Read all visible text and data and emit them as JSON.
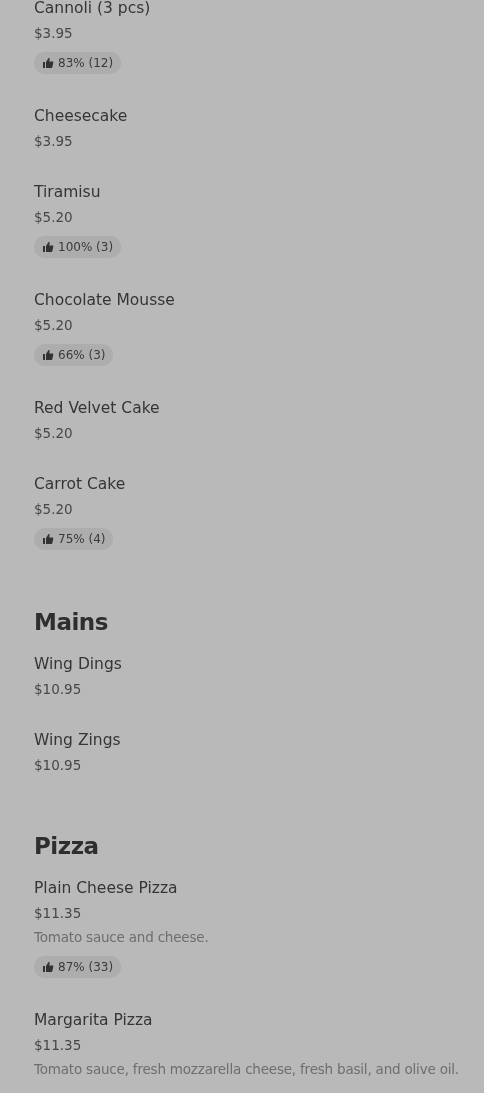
{
  "sections": [
    {
      "items": [
        {
          "name": "Cannoli (3 pcs)",
          "price": "$3.95",
          "rating": "83% (12)"
        },
        {
          "name": "Cheesecake",
          "price": "$3.95"
        },
        {
          "name": "Tiramisu",
          "price": "$5.20",
          "rating": "100% (3)"
        },
        {
          "name": "Chocolate Mousse",
          "price": "$5.20",
          "rating": "66% (3)"
        },
        {
          "name": "Red Velvet Cake",
          "price": "$5.20"
        },
        {
          "name": "Carrot Cake",
          "price": "$5.20",
          "rating": "75% (4)"
        }
      ]
    },
    {
      "title": "Mains",
      "items": [
        {
          "name": "Wing Dings",
          "price": "$10.95"
        },
        {
          "name": "Wing Zings",
          "price": "$10.95"
        }
      ]
    },
    {
      "title": "Pizza",
      "items": [
        {
          "name": "Plain Cheese Pizza",
          "price": "$11.35",
          "description": "Tomato sauce and cheese.",
          "rating": "87% (33)"
        },
        {
          "name": "Margarita Pizza",
          "price": "$11.35",
          "description": "Tomato sauce, fresh mozzarella cheese, fresh basil, and olive oil."
        }
      ]
    }
  ]
}
